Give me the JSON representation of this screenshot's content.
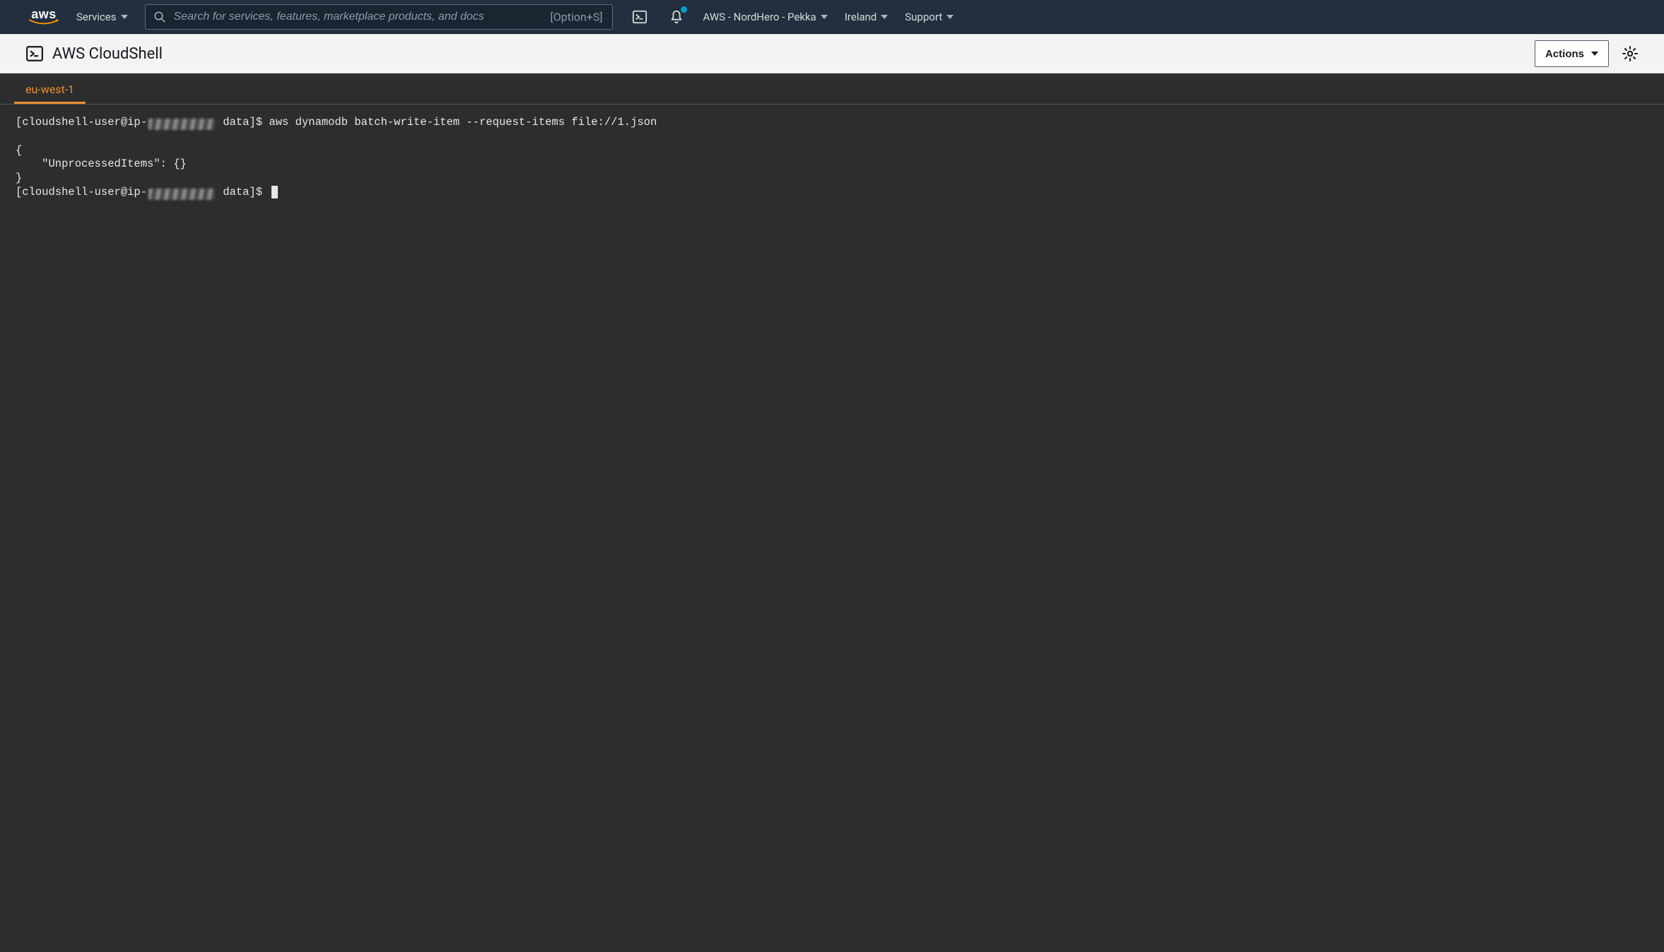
{
  "nav": {
    "logo_text": "aws",
    "services_label": "Services",
    "search_placeholder": "Search for services, features, marketplace products, and docs",
    "search_shortcut": "[Option+S]",
    "account_label": "AWS - NordHero - Pekka",
    "region_label": "Ireland",
    "support_label": "Support"
  },
  "subheader": {
    "title": "AWS CloudShell",
    "actions_label": "Actions"
  },
  "tabs": {
    "active_label": "eu-west-1"
  },
  "terminal": {
    "prompt1_user": "[cloudshell-user@ip-",
    "prompt1_suffix": " data]$ ",
    "command1": "aws dynamodb batch-write-item --request-items file://1.json",
    "output_line1": "{",
    "output_line2": "    \"UnprocessedItems\": {}",
    "output_line3": "}",
    "prompt2_user": "[cloudshell-user@ip-",
    "prompt2_suffix": " data]$ "
  }
}
